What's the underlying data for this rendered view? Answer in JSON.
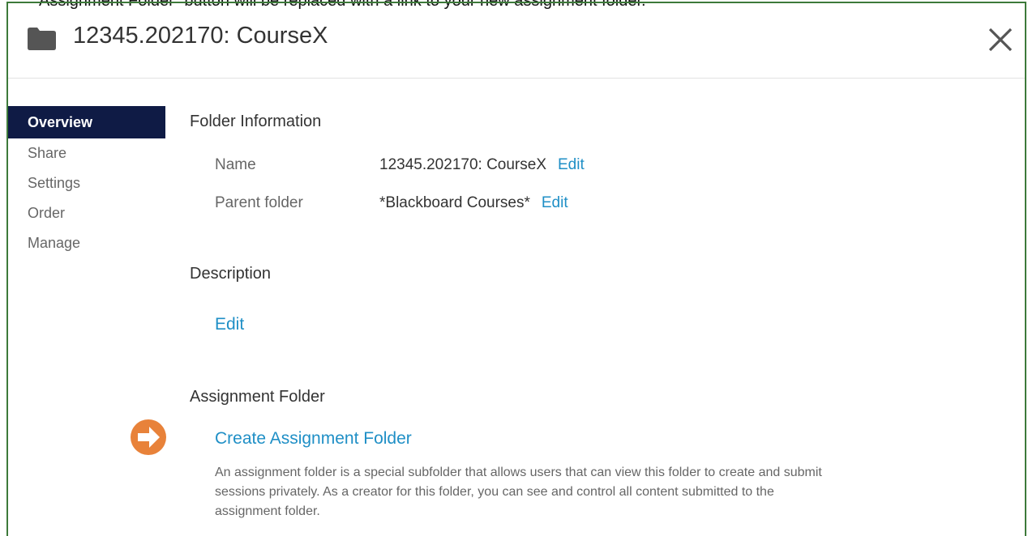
{
  "caption": "Assignment Folder\" button will be replaced with a link to your new assignment folder.",
  "dialog": {
    "title": "12345.202170: CourseX",
    "icons": {
      "folder": "folder-icon",
      "close": "close-icon",
      "callout": "arrow-right-circle-icon"
    },
    "colors": {
      "nav_active_bg": "#0f1b45",
      "link": "#1f8fc6",
      "frame_border": "#3d7a3a",
      "callout_arrow": "#e8823a"
    }
  },
  "nav": {
    "items": [
      {
        "label": "Overview",
        "active": true
      },
      {
        "label": "Share",
        "active": false
      },
      {
        "label": "Settings",
        "active": false
      },
      {
        "label": "Order",
        "active": false
      },
      {
        "label": "Manage",
        "active": false
      }
    ]
  },
  "folder_info": {
    "heading": "Folder Information",
    "name_label": "Name",
    "name_value": "12345.202170: CourseX",
    "name_edit": "Edit",
    "parent_label": "Parent folder",
    "parent_value": "*Blackboard Courses*",
    "parent_edit": "Edit"
  },
  "description": {
    "heading": "Description",
    "edit": "Edit"
  },
  "assignment": {
    "heading": "Assignment Folder",
    "create_link": "Create Assignment Folder",
    "text": "An assignment folder is a special subfolder that allows users that can view this folder to create and submit sessions privately. As a creator for this folder, you can see and control all content submitted to the assignment folder."
  }
}
